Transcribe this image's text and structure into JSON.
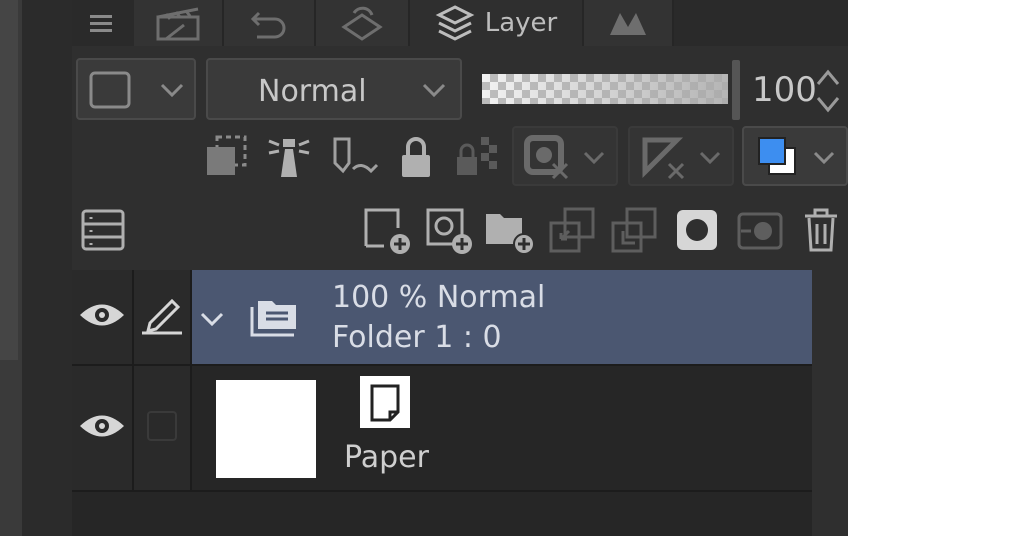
{
  "tabs": {
    "menu_icon": "hamburger-icon",
    "items": [
      {
        "icon": "clapper-icon",
        "label": ""
      },
      {
        "icon": "undo-history-icon",
        "label": ""
      },
      {
        "icon": "layer-property-icon",
        "label": ""
      },
      {
        "icon": "layers-icon",
        "label": "Layer",
        "active": true
      },
      {
        "icon": "navigator-icon",
        "label": ""
      }
    ]
  },
  "toolbar_row1": {
    "color_dropdown_icon": "square-outline-icon",
    "blend_mode": "Normal",
    "opacity_value": "100",
    "opacity_percent": 100
  },
  "toolbar_row2": {
    "icons": [
      "clip-to-layer-icon",
      "reference-layer-icon",
      "draft-layer-icon",
      "lock-icon",
      "lock-transparency-icon",
      "mask-disable-icon",
      "ruler-disable-icon",
      "layer-color-icon"
    ],
    "layer_color_accent": "#3d8ef0"
  },
  "toolbar_row3": {
    "icons": [
      "layer-list-toggle-icon",
      "new-raster-layer-icon",
      "new-vector-layer-icon",
      "new-folder-icon",
      "transfer-down-icon",
      "merge-down-icon",
      "create-mask-icon",
      "apply-mask-icon",
      "delete-icon"
    ]
  },
  "layers": [
    {
      "type": "folder",
      "blend_info": "100 % Normal",
      "name": "Folder 1 : 0",
      "selected": true,
      "color": "#4b5771"
    },
    {
      "type": "paper",
      "name": "Paper"
    }
  ]
}
